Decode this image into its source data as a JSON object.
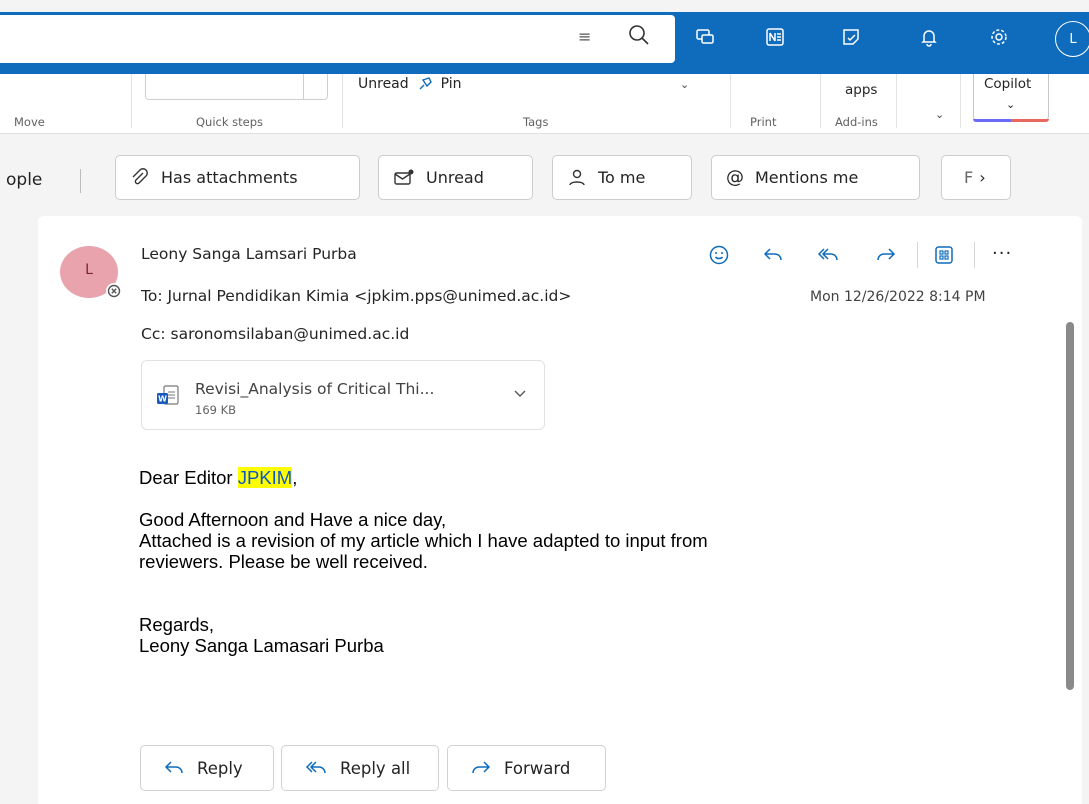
{
  "colors": {
    "accent": "#0f6cbd",
    "highlight": "#ffff00",
    "avatar_bg": "#e9a3ac"
  },
  "topbar": {
    "filter_glyph": "≡",
    "user_initial": "L"
  },
  "ribbon": {
    "groups": {
      "move": "Move",
      "quick_steps": "Quick steps",
      "tags": "Tags",
      "print": "Print",
      "addins": "Add-ins"
    },
    "unread": "Unread",
    "pin": "Pin",
    "apps": "apps",
    "copilot": "Copilot"
  },
  "filters": {
    "people_partial": "ople",
    "chips": [
      {
        "label": "Has attachments"
      },
      {
        "label": "Unread"
      },
      {
        "label": "To me"
      },
      {
        "label": "Mentions me"
      },
      {
        "label": "F"
      }
    ]
  },
  "message": {
    "avatar_initial": "L",
    "sender": "Leony Sanga Lamsari Purba",
    "to": "To: Jurnal Pendidikan Kimia <jpkim.pps@unimed.ac.id>",
    "cc": "Cc: saronomsilaban@unimed.ac.id",
    "date": "Mon 12/26/2022 8:14 PM",
    "more": "···",
    "attachment": {
      "name": "Revisi_Analysis of Critical Thi...",
      "size": "169 KB"
    },
    "body": {
      "greeting_pre": "Dear Editor ",
      "greeting_highlight": "JPKIM",
      "greeting_post": ",",
      "line1": "Good Afternoon and Have a nice day,",
      "line2": "Attached is a revision of my article which I have adapted to input from",
      "line3": "reviewers. Please be well received.",
      "regards": "Regards,",
      "signature": "Leony Sanga Lamasari Purba"
    }
  },
  "actions": {
    "reply": "Reply",
    "reply_all": "Reply all",
    "forward": "Forward"
  }
}
